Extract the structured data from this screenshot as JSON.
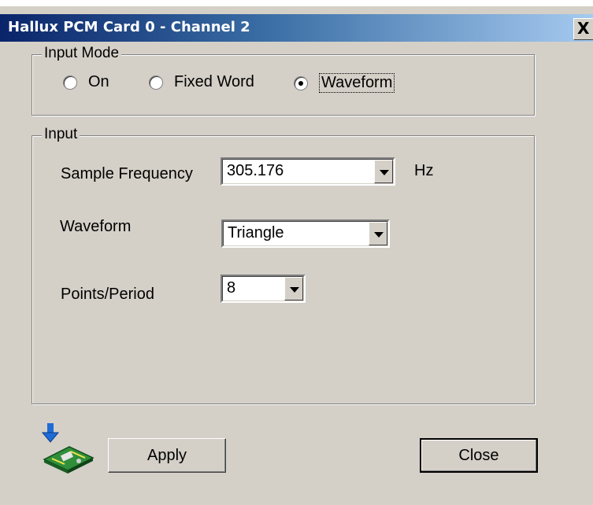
{
  "window": {
    "title": "Hallux PCM Card 0 - Channel 2",
    "close_glyph": "X"
  },
  "input_mode": {
    "legend": "Input Mode",
    "options": [
      {
        "label": "On",
        "selected": false
      },
      {
        "label": "Fixed Word",
        "selected": false
      },
      {
        "label": "Waveform",
        "selected": true
      }
    ]
  },
  "input": {
    "legend": "Input",
    "sample_frequency": {
      "label": "Sample Frequency",
      "value": "305.176",
      "unit": "Hz"
    },
    "waveform": {
      "label": "Waveform",
      "value": "Triangle"
    },
    "points_per_period": {
      "label": "Points/Period",
      "value": "8"
    }
  },
  "buttons": {
    "apply_label": "Apply",
    "close_label": "Close"
  },
  "icons": {
    "apply_icon": "download-card-icon"
  }
}
